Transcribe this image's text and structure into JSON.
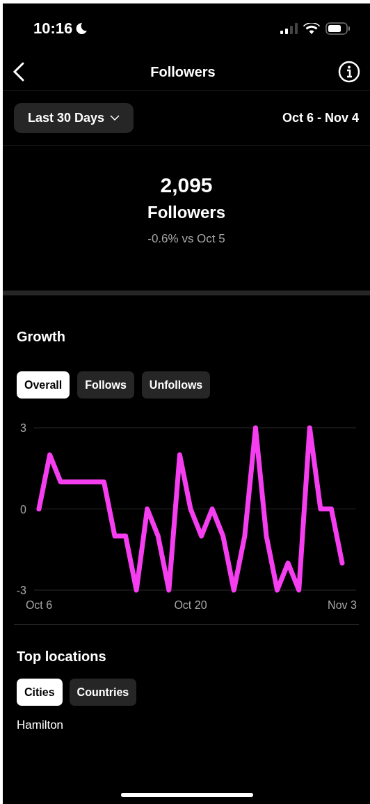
{
  "status_bar": {
    "time": "10:16"
  },
  "header": {
    "title": "Followers"
  },
  "date_range": {
    "label": "Last 30 Days",
    "range": "Oct 6 - Nov 4"
  },
  "summary": {
    "count": "2,095",
    "label": "Followers",
    "change": "-0.6% vs Oct 5"
  },
  "growth": {
    "title": "Growth",
    "tabs": [
      {
        "label": "Overall",
        "selected": true
      },
      {
        "label": "Follows",
        "selected": false
      },
      {
        "label": "Unfollows",
        "selected": false
      }
    ],
    "chart_data": {
      "type": "line",
      "categories": [
        "Oct 6",
        null,
        null,
        null,
        null,
        null,
        null,
        null,
        null,
        null,
        null,
        null,
        null,
        null,
        "Oct 20",
        null,
        null,
        null,
        null,
        null,
        null,
        null,
        null,
        null,
        null,
        null,
        null,
        null,
        "Nov 3"
      ],
      "series": [
        {
          "color": "#f53ef0",
          "values": [
            0,
            2,
            1,
            1,
            1,
            1,
            1,
            -1,
            -1,
            -3,
            0,
            -1,
            -3,
            2,
            0,
            -1,
            0,
            -1,
            -3,
            -1,
            3,
            -1,
            -3,
            -2,
            -3,
            3,
            0,
            0,
            -2
          ]
        }
      ],
      "ylim": [
        -3,
        3
      ],
      "yticks": [
        3,
        0,
        -3
      ]
    }
  },
  "top_locations": {
    "title": "Top locations",
    "tabs": [
      {
        "label": "Cities",
        "selected": true
      },
      {
        "label": "Countries",
        "selected": false
      }
    ],
    "items": [
      "Hamilton"
    ]
  }
}
